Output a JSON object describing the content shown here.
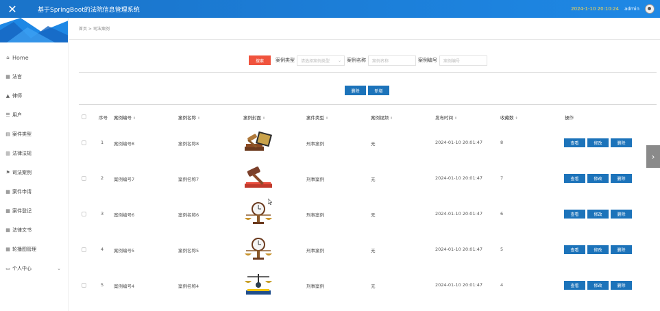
{
  "header": {
    "title": "基于SpringBoot的法院信息管理系统",
    "datetime": "2024-1-10 20:10:24",
    "username": "admin"
  },
  "sidebar": {
    "items": [
      {
        "label": "Home",
        "icon": "home-icon"
      },
      {
        "label": "法官",
        "icon": "grid-icon"
      },
      {
        "label": "律师",
        "icon": "building-icon"
      },
      {
        "label": "用户",
        "icon": "list-icon"
      },
      {
        "label": "案件类型",
        "icon": "doc-icon"
      },
      {
        "label": "法律法规",
        "icon": "bar-chart-icon"
      },
      {
        "label": "司法案例",
        "icon": "flag-icon"
      },
      {
        "label": "案件申请",
        "icon": "grid-icon"
      },
      {
        "label": "案件登记",
        "icon": "grid-icon"
      },
      {
        "label": "法律文书",
        "icon": "grid-icon"
      },
      {
        "label": "轮播图管理",
        "icon": "grid-icon"
      },
      {
        "label": "个人中心",
        "icon": "window-icon"
      }
    ]
  },
  "breadcrumb": "首页 > 司法案例",
  "search": {
    "button": "搜索",
    "type_label": "案例类型",
    "type_placeholder": "请选择案例类型",
    "name_label": "案例名称",
    "name_placeholder": "案例名称",
    "code_label": "案例编号",
    "code_placeholder": "案例编号"
  },
  "actions": {
    "delete": "删除",
    "add": "新增"
  },
  "table": {
    "headers": {
      "index": "序号",
      "code": "案例编号",
      "name": "案例名称",
      "cover": "案例封面",
      "type": "案件类型",
      "video": "案例视频",
      "time": "发布时间",
      "favorites": "收藏数",
      "ops": "操作"
    },
    "op_labels": {
      "view": "查看",
      "edit": "修改",
      "delete": "删除"
    },
    "rows": [
      {
        "index": "1",
        "code": "案例编号8",
        "name": "案例名称8",
        "type": "刑事案例",
        "video": "无",
        "time": "2024-01-10 20:01:47",
        "favorites": "8",
        "cover": "gavel-book"
      },
      {
        "index": "2",
        "code": "案例编号7",
        "name": "案例名称7",
        "type": "刑事案例",
        "video": "无",
        "time": "2024-01-10 20:01:47",
        "favorites": "7",
        "cover": "gavel-red"
      },
      {
        "index": "3",
        "code": "案例编号6",
        "name": "案例名称6",
        "type": "刑事案例",
        "video": "无",
        "time": "2024-01-10 20:01:47",
        "favorites": "6",
        "cover": "scale-clock"
      },
      {
        "index": "4",
        "code": "案例编号5",
        "name": "案例名称5",
        "type": "刑事案例",
        "video": "无",
        "time": "2024-01-10 20:01:47",
        "favorites": "5",
        "cover": "scale-clock"
      },
      {
        "index": "5",
        "code": "案例编号4",
        "name": "案例名称4",
        "type": "刑事案例",
        "video": "无",
        "time": "2024-01-10 20:01:47",
        "favorites": "4",
        "cover": "scale-book"
      }
    ]
  },
  "colors": {
    "topbar": "#1e88e5",
    "search_button": "#f0533d",
    "action_button": "#1c73ba",
    "datetime": "#ffd84a"
  }
}
